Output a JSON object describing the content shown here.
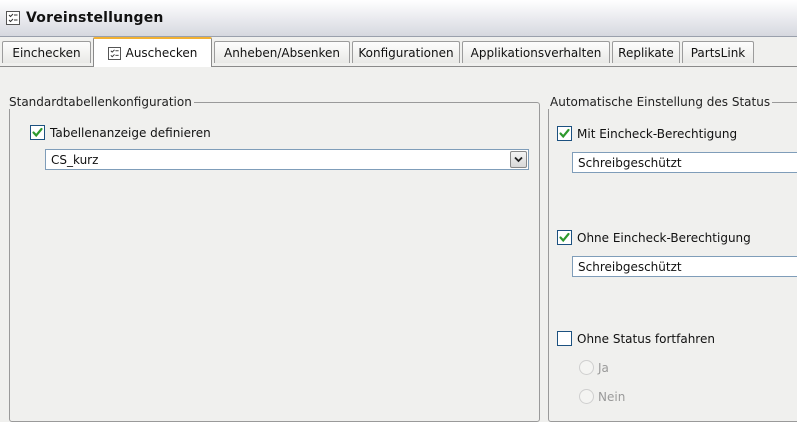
{
  "window": {
    "title": "Voreinstellungen"
  },
  "tabs": [
    {
      "label": "Einchecken"
    },
    {
      "label": "Auschecken"
    },
    {
      "label": "Anheben/Absenken"
    },
    {
      "label": "Konfigurationen"
    },
    {
      "label": "Applikationsverhalten"
    },
    {
      "label": "Replikate"
    },
    {
      "label": "PartsLink"
    }
  ],
  "left_group": {
    "title": "Standardtabellenkonfiguration",
    "checkbox_label": "Tabellenanzeige definieren",
    "combo_value": "CS_kurz"
  },
  "right_group": {
    "title": "Automatische Einstellung des Status",
    "with_permission": {
      "label": "Mit Eincheck-Berechtigung",
      "value": "Schreibgeschützt"
    },
    "without_permission": {
      "label": "Ohne Eincheck-Berechtigung",
      "value": "Schreibgeschützt"
    },
    "no_status": {
      "label": "Ohne Status fortfahren"
    },
    "radio_yes": "Ja",
    "radio_no": "Nein"
  },
  "colors": {
    "check": "#2e9a2e",
    "active_tab_border": "#f2b134",
    "combo_border": "#7f9db9"
  }
}
